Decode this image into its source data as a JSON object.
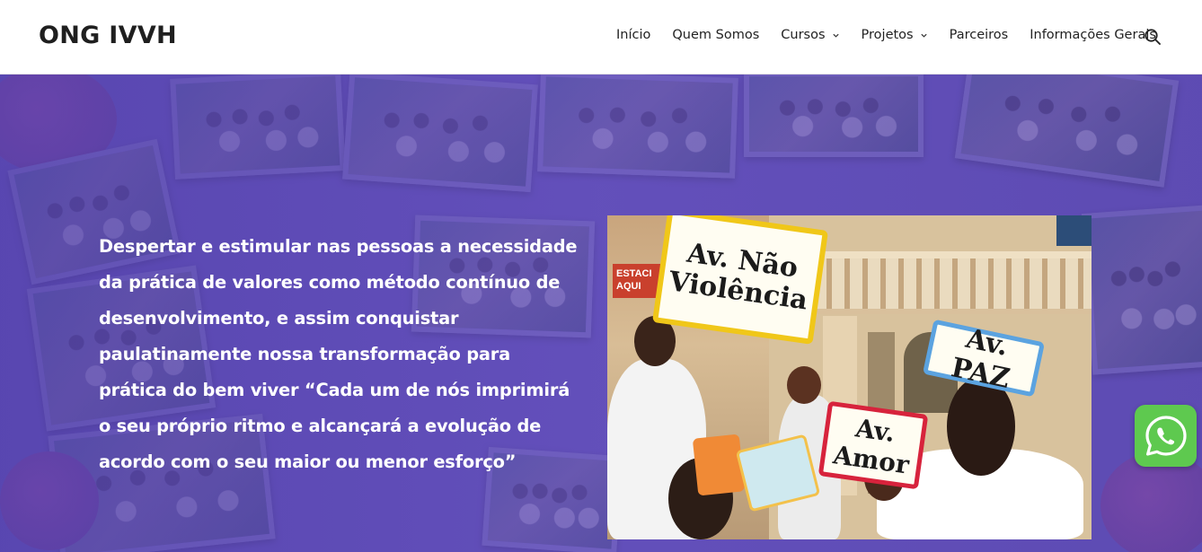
{
  "site": {
    "title": "ONG IVVH"
  },
  "nav": {
    "items": [
      {
        "label": "Início",
        "dropdown": false
      },
      {
        "label": "Quem Somos",
        "dropdown": false
      },
      {
        "label": "Cursos",
        "dropdown": true
      },
      {
        "label": "Projetos",
        "dropdown": true
      },
      {
        "label": "Parceiros",
        "dropdown": false
      },
      {
        "label": "Informações Gerais",
        "dropdown": false
      }
    ],
    "search_icon": "search-icon"
  },
  "hero": {
    "mission_text": "Despertar e estimular nas pessoas a necessidade da prática de valores como método contínuo de desenvolvimento, e assim conquistar paulatinamente nossa transformação para prática do bem viver “Cada um de nós imprimirá o seu próprio ritmo e alcançará a evolução de acordo com o seu maior ou menor esforço”",
    "photo_signs": {
      "violencia": "Av. Não Violência",
      "paz": "Av. PAZ",
      "amor": "Av. Amor",
      "estacionamento": "ESTACI AQUI"
    },
    "overlay_color": "#5a48a8"
  },
  "whatsapp": {
    "icon": "whatsapp-icon",
    "color": "#5ec94f"
  }
}
